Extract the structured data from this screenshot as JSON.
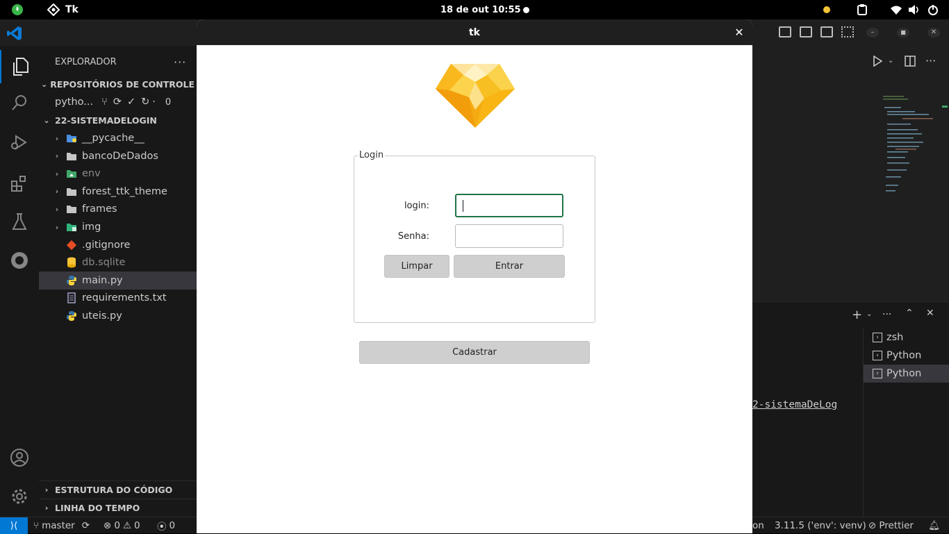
{
  "system_bar": {
    "app_name": "Tk",
    "clock": "18 de out  10:55"
  },
  "vscode": {
    "explorer_title": "EXPLORADOR",
    "scm_section": "REPOSITÓRIOS DE CONTROLE D...",
    "scm_repo": "pytho...",
    "scm_count": "0",
    "project_section": "22-SISTEMADELOGIN",
    "tree": [
      {
        "label": "__pycache__",
        "kind": "folder-blue",
        "chevron": true
      },
      {
        "label": "bancoDeDados",
        "kind": "folder",
        "chevron": true
      },
      {
        "label": "env",
        "kind": "folder-green",
        "chevron": true
      },
      {
        "label": "forest_ttk_theme",
        "kind": "folder",
        "chevron": true
      },
      {
        "label": "frames",
        "kind": "folder",
        "chevron": true
      },
      {
        "label": "img",
        "kind": "folder-img",
        "chevron": true
      },
      {
        "label": ".gitignore",
        "kind": "git",
        "chevron": false
      },
      {
        "label": "db.sqlite",
        "kind": "db",
        "chevron": false
      },
      {
        "label": "main.py",
        "kind": "python",
        "chevron": false,
        "selected": true
      },
      {
        "label": "requirements.txt",
        "kind": "txt",
        "chevron": false
      },
      {
        "label": "uteis.py",
        "kind": "python",
        "chevron": false
      }
    ],
    "outline_section": "ESTRUTURA DO CÓDIGO",
    "timeline_section": "LINHA DO TEMPO",
    "terminal_tabs": [
      "zsh",
      "Python",
      "Python"
    ],
    "terminal_path_fragment": "2-sistemaDeLog",
    "status": {
      "branch": "master",
      "errors": "0",
      "warnings": "0",
      "ports": "0",
      "lang_fragment": "on",
      "interpreter": "3.11.5 ('env': venv)",
      "formatter": "Prettier"
    }
  },
  "tk": {
    "window_title": "tk",
    "frame_label": "Login",
    "login_label": "login:",
    "password_label": "Senha:",
    "login_value": "",
    "password_value": "",
    "clear_button": "Limpar",
    "submit_button": "Entrar",
    "register_button": "Cadastrar"
  },
  "colors": {
    "vscode_accent": "#0078d4",
    "focus_ring": "#217346",
    "button_bg": "#cfcfcf"
  }
}
